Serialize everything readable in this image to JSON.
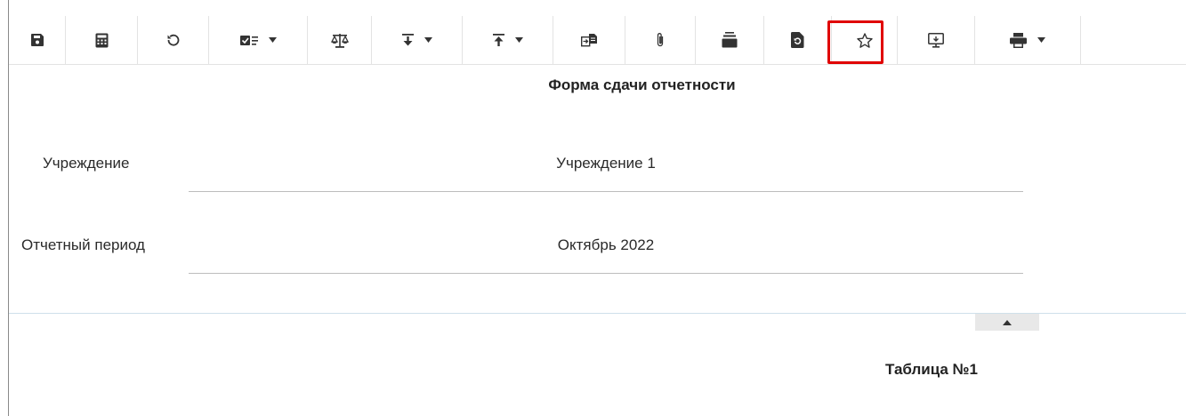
{
  "toolbar": {
    "buttons": [
      {
        "name": "save-icon"
      },
      {
        "name": "calculator-icon"
      },
      {
        "name": "refresh-icon"
      },
      {
        "name": "checklist-icon",
        "dropdown": true
      },
      {
        "name": "scales-icon"
      },
      {
        "name": "import-down-icon",
        "dropdown": true
      },
      {
        "name": "export-up-icon",
        "dropdown": true
      },
      {
        "name": "transfer-icon"
      },
      {
        "name": "paperclip-icon"
      },
      {
        "name": "layers-icon"
      },
      {
        "name": "document-refresh-icon",
        "highlighted": true
      },
      {
        "name": "star-icon"
      },
      {
        "name": "monitor-icon"
      },
      {
        "name": "printer-icon",
        "dropdown": true
      }
    ],
    "highlight_color": "#e00000"
  },
  "form": {
    "title": "Форма сдачи отчетности",
    "institution_label": "Учреждение",
    "institution_value": "Учреждение 1",
    "period_label": "Отчетный период",
    "period_value": "Октябрь 2022"
  },
  "section": {
    "table_title": "Таблица №1"
  }
}
